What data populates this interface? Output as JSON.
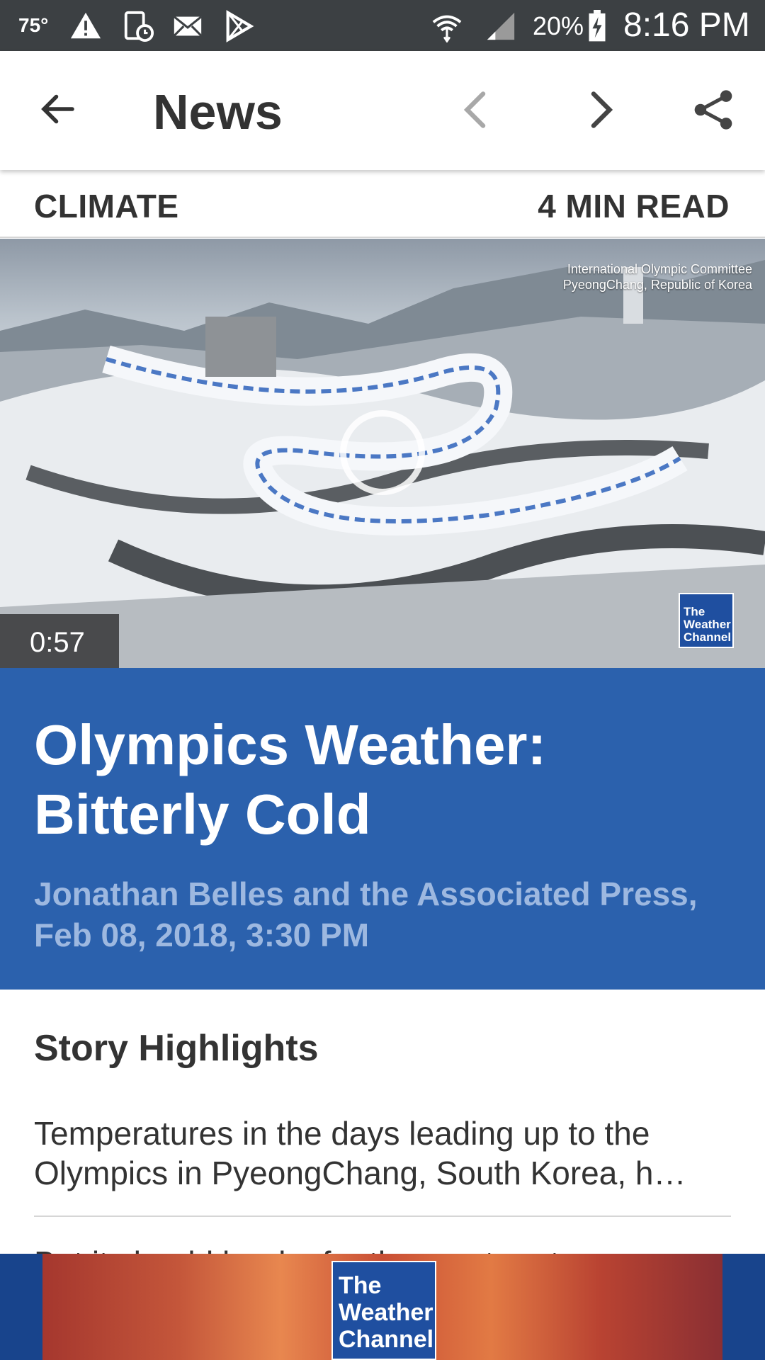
{
  "status_bar": {
    "temperature": "75°",
    "battery": "20%",
    "time": "8:16 PM",
    "icons": [
      "warning-icon",
      "device-icon",
      "mail-icon",
      "play-store-icon",
      "wifi-icon",
      "signal-icon",
      "battery-charging-icon"
    ]
  },
  "app_bar": {
    "title": "News",
    "icons": [
      "back-arrow-icon",
      "chevron-left-icon",
      "chevron-right-icon",
      "share-icon"
    ]
  },
  "meta": {
    "category": "CLIMATE",
    "read_time": "4 MIN READ"
  },
  "video": {
    "credit_line1": "International Olympic Committee",
    "credit_line2": "PyeongChang, Republic of Korea",
    "duration": "0:57",
    "badge_text": "The Weather Channel"
  },
  "article": {
    "title": "Olympics Weather: Bitterly Cold",
    "byline": "Jonathan Belles and the Associated Press, Feb 08, 2018, 3:30 PM",
    "highlights_heading": "Story Highlights",
    "highlights": [
      "Temperatures in the days leading up to the Olympics in PyeongChang, South Korea, h…",
      "But it should be dry for the most part"
    ]
  },
  "banner_ad": {
    "logo_text": "The Weather Channel"
  },
  "colors": {
    "status_bar": "#3c4043",
    "headline_bg": "#2b61ad",
    "byline": "#9db8e0",
    "text_dark": "#333333",
    "banner_bg": "#18448c"
  }
}
